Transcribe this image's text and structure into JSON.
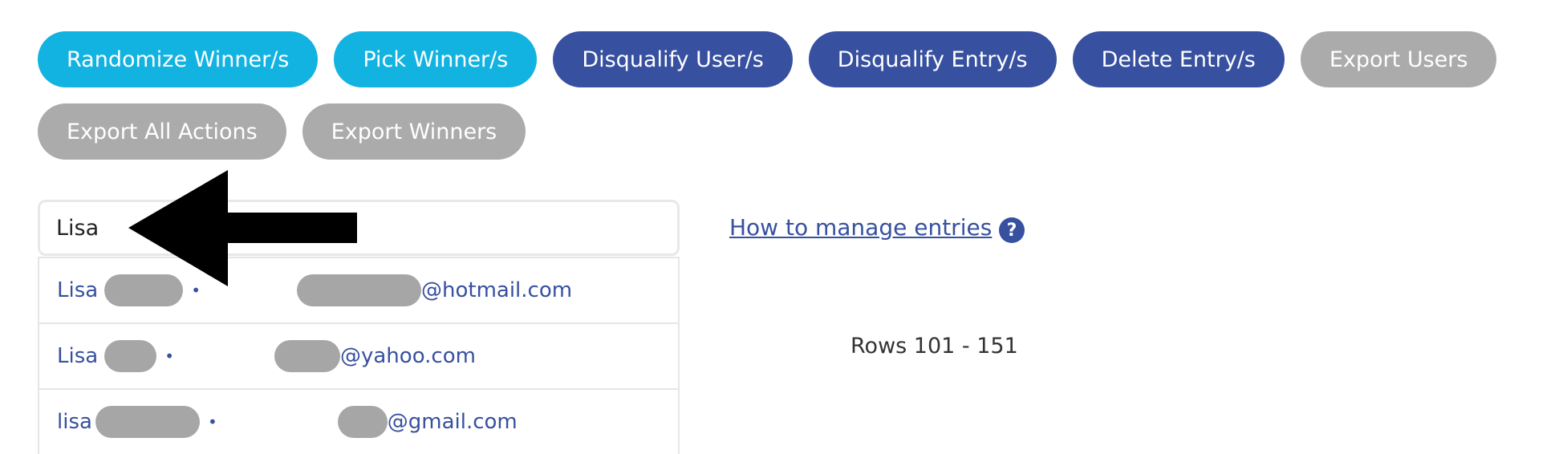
{
  "actions": {
    "randomize_winner": "Randomize Winner/s",
    "pick_winner": "Pick Winner/s",
    "disqualify_user": "Disqualify User/s",
    "disqualify_entry": "Disqualify Entry/s",
    "delete_entry": "Delete Entry/s",
    "export_users": "Export Users",
    "export_all_actions": "Export All Actions",
    "export_winners": "Export Winners"
  },
  "search": {
    "value": "Lisa"
  },
  "results": [
    {
      "name": "Lisa",
      "domain": "@hotmail.com"
    },
    {
      "name": "Lisa",
      "domain": "@yahoo.com"
    },
    {
      "name": "lisa",
      "domain": "@gmail.com"
    }
  ],
  "help": {
    "link_text": "How to manage entries",
    "icon_glyph": "?"
  },
  "pagination": {
    "rows_label": "Rows 101 - 151"
  },
  "colors": {
    "cyan": "#12b3e0",
    "navy": "#37509f",
    "gray": "#ababab"
  }
}
